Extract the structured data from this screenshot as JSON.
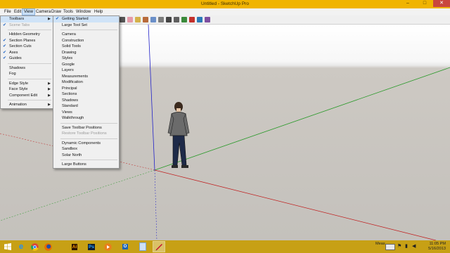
{
  "window": {
    "title": "Untitled - SketchUp Pro",
    "minimize": "–",
    "maximize": "□",
    "close": "✕"
  },
  "menubar": [
    "File",
    "Edit",
    "View",
    "Camera",
    "Draw",
    "Tools",
    "Window",
    "Help"
  ],
  "view_menu": {
    "items": [
      {
        "label": "Toolbars",
        "check": false,
        "submenu": true,
        "highlighted": true
      },
      {
        "label": "Scene Tabs",
        "check": true,
        "disabled": true
      },
      {
        "sep": true
      },
      {
        "label": "Hidden Geometry",
        "check": false
      },
      {
        "label": "Section Planes",
        "check": true
      },
      {
        "label": "Section Cuts",
        "check": true
      },
      {
        "label": "Axes",
        "check": true
      },
      {
        "label": "Guides",
        "check": true
      },
      {
        "sep": true
      },
      {
        "label": "Shadows",
        "check": false
      },
      {
        "label": "Fog",
        "check": false
      },
      {
        "sep": true
      },
      {
        "label": "Edge Style",
        "submenu": true
      },
      {
        "label": "Face Style",
        "submenu": true
      },
      {
        "label": "Component Edit",
        "submenu": true
      },
      {
        "sep": true
      },
      {
        "label": "Animation",
        "submenu": true
      }
    ]
  },
  "toolbars_menu": {
    "items": [
      {
        "label": "Getting Started",
        "check": true,
        "highlighted": true
      },
      {
        "label": "Large Tool Set"
      },
      {
        "sep": true
      },
      {
        "label": "Camera"
      },
      {
        "label": "Construction"
      },
      {
        "label": "Solid Tools"
      },
      {
        "label": "Drawing"
      },
      {
        "label": "Styles"
      },
      {
        "label": "Google"
      },
      {
        "label": "Layers"
      },
      {
        "label": "Measurements"
      },
      {
        "label": "Modification"
      },
      {
        "label": "Principal"
      },
      {
        "label": "Sections"
      },
      {
        "label": "Shadows"
      },
      {
        "label": "Standard"
      },
      {
        "label": "Views"
      },
      {
        "label": "Walkthrough"
      },
      {
        "sep": true
      },
      {
        "label": "Save Toolbar Positions"
      },
      {
        "label": "Restore Toolbar Positions",
        "disabled": true
      },
      {
        "sep": true
      },
      {
        "label": "Dynamic Components"
      },
      {
        "label": "Sandbox"
      },
      {
        "label": "Solar North"
      },
      {
        "sep": true
      },
      {
        "label": "Large Buttons"
      }
    ]
  },
  "toolbar_icons": [
    "select-icon",
    "eraser-icon",
    "paint-bucket-icon",
    "push-pull-icon",
    "orbit-icon",
    "pan-icon",
    "zoom-icon",
    "zoom-extents-icon",
    "add-location-icon",
    "warehouse-icon",
    "share-model-icon",
    "extension-icon"
  ],
  "taskbar": {
    "apps": [
      {
        "name": "windows-start-icon",
        "color": "#ffffff"
      },
      {
        "name": "internet-explorer-icon",
        "color": "#1e90ff"
      },
      {
        "name": "chrome-icon",
        "color": "#d9463b"
      },
      {
        "name": "firefox-icon",
        "color": "#e66a00"
      },
      {
        "name": "illustrator-icon",
        "color": "#2b1300"
      },
      {
        "name": "photoshop-icon",
        "color": "#0b1c34"
      },
      {
        "name": "media-player-icon",
        "color": "#e87f1c"
      },
      {
        "name": "outlook-icon",
        "color": "#1f66b5"
      },
      {
        "name": "notepad-icon",
        "color": "#7aa6d8"
      },
      {
        "name": "sketchup-icon",
        "color": "#c8102e"
      }
    ],
    "tray_label": "Meas",
    "time": "11:05 PM",
    "date": "5/16/2013"
  },
  "colors": {
    "titlebar": "#f0b400",
    "taskbar": "#c7a015",
    "axis_red": "#c02020",
    "axis_green": "#2a9a2a",
    "axis_blue": "#2020c8",
    "menu_highlight": "#cfe3f7"
  }
}
